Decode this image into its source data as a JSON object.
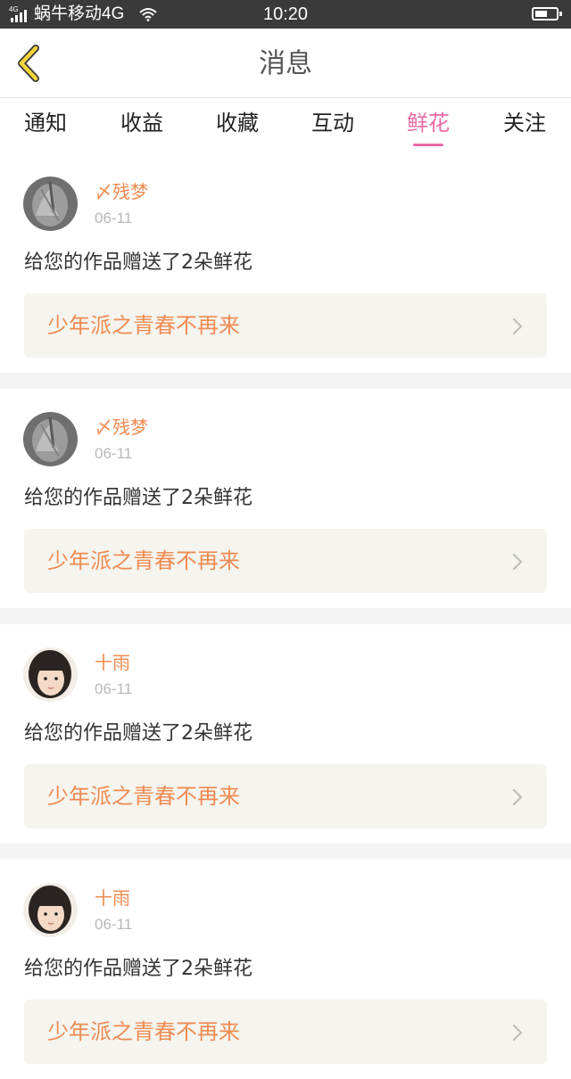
{
  "status_bar": {
    "network": "4G",
    "carrier": "蜗牛移动4G",
    "time": "10:20",
    "battery_level": 0.6
  },
  "header": {
    "title": "消息",
    "back_icon": "chevron-left-icon"
  },
  "tabs": [
    {
      "label": "通知",
      "active": false
    },
    {
      "label": "收益",
      "active": false
    },
    {
      "label": "收藏",
      "active": false
    },
    {
      "label": "互动",
      "active": false
    },
    {
      "label": "鲜花",
      "active": true
    },
    {
      "label": "关注",
      "active": false
    }
  ],
  "colors": {
    "accent_pink": "#ea6aa4",
    "accent_orange": "#ef8b51",
    "back_icon_yellow": "#f2d33a"
  },
  "messages": [
    {
      "username": "〆残梦",
      "date": "06-11",
      "text": "给您的作品赠送了2朵鲜花",
      "work_title": "少年派之青春不再来"
    },
    {
      "username": "〆残梦",
      "date": "06-11",
      "text": "给您的作品赠送了2朵鲜花",
      "work_title": "少年派之青春不再来"
    },
    {
      "username": "十雨",
      "date": "06-11",
      "text": "给您的作品赠送了2朵鲜花",
      "work_title": "少年派之青春不再来"
    },
    {
      "username": "十雨",
      "date": "06-11",
      "text": "给您的作品赠送了2朵鲜花",
      "work_title": "少年派之青春不再来"
    }
  ]
}
